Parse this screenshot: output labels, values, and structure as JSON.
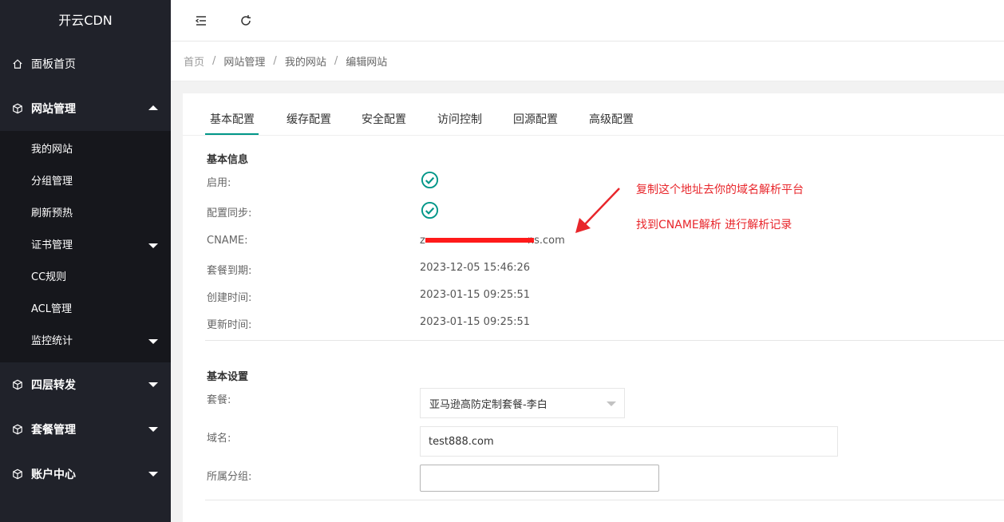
{
  "app": {
    "title": "开云CDN"
  },
  "sidebar": {
    "items": [
      {
        "label": "面板首页"
      },
      {
        "label": "网站管理"
      },
      {
        "label": "四层转发"
      },
      {
        "label": "套餐管理"
      },
      {
        "label": "账户中心"
      }
    ],
    "sub_items": [
      {
        "label": "我的网站"
      },
      {
        "label": "分组管理"
      },
      {
        "label": "刷新预热"
      },
      {
        "label": "证书管理"
      },
      {
        "label": "CC规则"
      },
      {
        "label": "ACL管理"
      },
      {
        "label": "监控统计"
      }
    ]
  },
  "breadcrumb": [
    "首页",
    "网站管理",
    "我的网站",
    "编辑网站"
  ],
  "tabs": [
    "基本配置",
    "缓存配置",
    "安全配置",
    "访问控制",
    "回源配置",
    "高级配置"
  ],
  "basic_info": {
    "title": "基本信息",
    "enabled_label": "启用:",
    "sync_label": "配置同步:",
    "cname_label": "CNAME:",
    "cname_value_prefix": "z",
    "cname_value_suffix": "ns.com",
    "expire_label": "套餐到期:",
    "expire_value": "2023-12-05 15:46:26",
    "created_label": "创建时间:",
    "created_value": "2023-01-15 09:25:51",
    "updated_label": "更新时间:",
    "updated_value": "2023-01-15 09:25:51"
  },
  "basic_settings": {
    "title": "基本设置",
    "plan_label": "套餐:",
    "plan_value": "亚马逊高防定制套餐-李白",
    "domain_label": "域名:",
    "domain_value": "test888.com",
    "group_label": "所属分组:",
    "group_value": ""
  },
  "annotations": {
    "line1": "复制这个地址去你的域名解析平台",
    "line2": "找到CNAME解析  进行解析记录"
  },
  "colors": {
    "accent": "#009688",
    "sidebar_bg": "#20222a",
    "annotation": "#e8262b"
  }
}
